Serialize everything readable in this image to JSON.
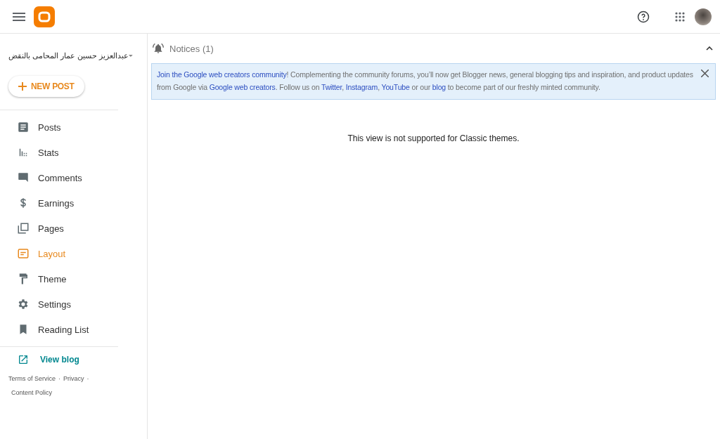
{
  "blog_selector": {
    "name": "عبدالعزيز حسين عمار المحامى بالنقض"
  },
  "new_post": "NEW POST",
  "nav": [
    {
      "label": "Posts",
      "selected": false
    },
    {
      "label": "Stats",
      "selected": false
    },
    {
      "label": "Comments",
      "selected": false
    },
    {
      "label": "Earnings",
      "selected": false
    },
    {
      "label": "Pages",
      "selected": false
    },
    {
      "label": "Layout",
      "selected": true
    },
    {
      "label": "Theme",
      "selected": false
    },
    {
      "label": "Settings",
      "selected": false
    },
    {
      "label": "Reading List",
      "selected": false
    }
  ],
  "view_blog": "View blog",
  "footer_links": [
    {
      "label": "Terms of Service",
      "separator": "·"
    },
    {
      "label": "Privacy",
      "separator": "·"
    },
    {
      "label": "Content Policy"
    }
  ],
  "notices": {
    "title": "Notices (1)",
    "expanded": true,
    "message": [
      {
        "text": "Join the Google web creators community",
        "link": true
      },
      {
        "text": "! Complementing the community forums, you’ll now get Blogger news, general blogging tips and inspiration, and product updates from Google via ",
        "link": false
      },
      {
        "text": "Google web creators",
        "link": true
      },
      {
        "text": ". Follow us on ",
        "link": false
      },
      {
        "text": "Twitter",
        "link": true
      },
      {
        "text": ", ",
        "link": false
      },
      {
        "text": "Instagram",
        "link": true
      },
      {
        "text": ", ",
        "link": false
      },
      {
        "text": "YouTube",
        "link": true
      },
      {
        "text": " or our ",
        "link": false
      },
      {
        "text": "blog",
        "link": true
      },
      {
        "text": " to become part of our freshly minted community.",
        "link": false
      }
    ]
  },
  "main_message": "This view is not supported for Classic themes."
}
